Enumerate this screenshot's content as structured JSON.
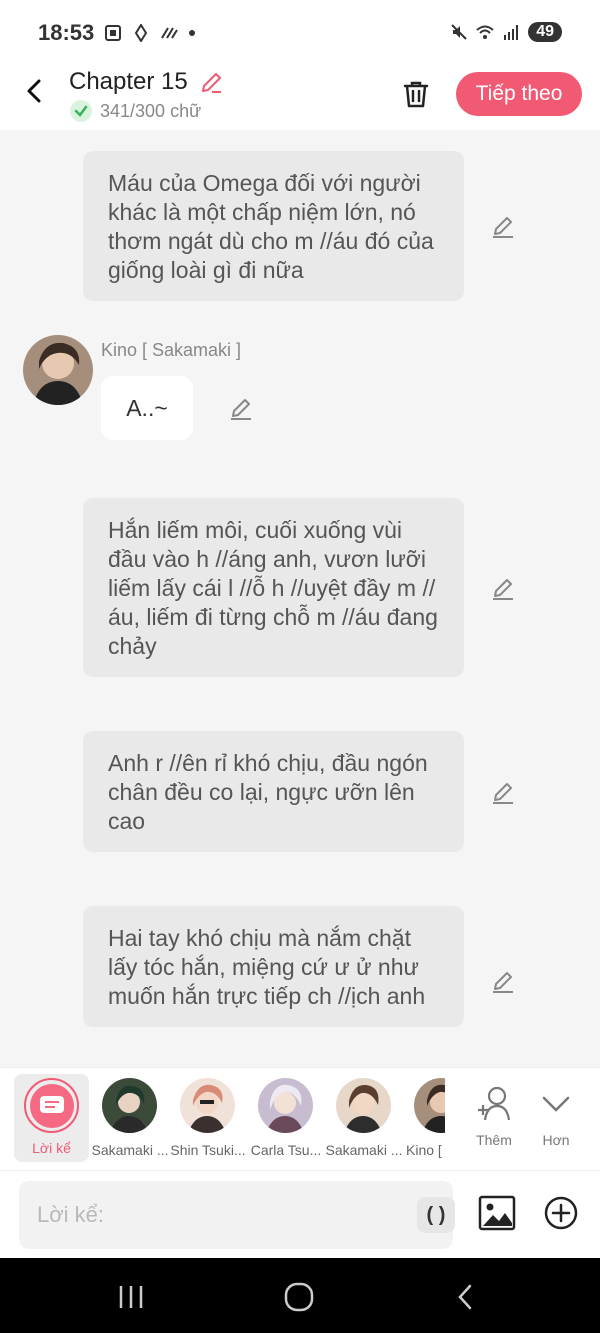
{
  "status": {
    "time": "18:53",
    "battery": "49"
  },
  "header": {
    "title": "Chapter 15",
    "word_count": "341/300 chữ",
    "next_label": "Tiếp theo"
  },
  "messages": [
    {
      "text": "Máu của Omega đối với người khác là một chấp niệm lớn, nó thơm ngát dù cho m //áu đó của giống loài gì đi nữa"
    },
    {
      "character": "Kino [ Sakamaki ]",
      "text": "A..~"
    },
    {
      "text": "Hắn liếm môi, cuối xuống vùi đầu vào h //áng anh, vươn lưỡi liếm lấy cái l //ỗ h //uyệt đầy m //áu, liếm đi từng chỗ m //áu đang chảy"
    },
    {
      "text": "Anh r //ên rỉ khó chịu, đầu ngón chân đều co lại, ngực ưỡn lên cao"
    },
    {
      "text": "Hai tay khó chịu mà nắm chặt lấy tóc hắn, miệng cứ ư ử như muốn hắn trực tiếp ch //ịch anh"
    }
  ],
  "character_bar": {
    "narrator_label": "Lời kể",
    "characters": [
      {
        "label": "Sakamaki ...",
        "color": "#3c4a3a"
      },
      {
        "label": "Shin Tsuki...",
        "color": "#d9a88f"
      },
      {
        "label": "Carla Tsu...",
        "color": "#c8bcd0"
      },
      {
        "label": "Sakamaki ...",
        "color": "#8a6a58"
      },
      {
        "label": "Kino [",
        "color": "#6b4f3d"
      }
    ],
    "more_label": "Thêm",
    "less_label": "Hơn"
  },
  "input": {
    "placeholder": "Lời kể:",
    "paren_label": "( )"
  },
  "colors": {
    "accent": "#f25a74",
    "bubble": "#e9e9e9"
  }
}
